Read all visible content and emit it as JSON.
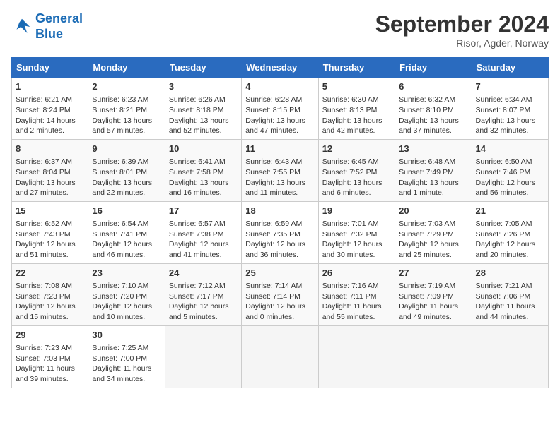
{
  "logo": {
    "line1": "General",
    "line2": "Blue"
  },
  "title": "September 2024",
  "subtitle": "Risor, Agder, Norway",
  "days_header": [
    "Sunday",
    "Monday",
    "Tuesday",
    "Wednesday",
    "Thursday",
    "Friday",
    "Saturday"
  ],
  "weeks": [
    [
      {
        "day": "1",
        "sunrise": "6:21 AM",
        "sunset": "8:24 PM",
        "daylight": "14 hours and 2 minutes."
      },
      {
        "day": "2",
        "sunrise": "6:23 AM",
        "sunset": "8:21 PM",
        "daylight": "13 hours and 57 minutes."
      },
      {
        "day": "3",
        "sunrise": "6:26 AM",
        "sunset": "8:18 PM",
        "daylight": "13 hours and 52 minutes."
      },
      {
        "day": "4",
        "sunrise": "6:28 AM",
        "sunset": "8:15 PM",
        "daylight": "13 hours and 47 minutes."
      },
      {
        "day": "5",
        "sunrise": "6:30 AM",
        "sunset": "8:13 PM",
        "daylight": "13 hours and 42 minutes."
      },
      {
        "day": "6",
        "sunrise": "6:32 AM",
        "sunset": "8:10 PM",
        "daylight": "13 hours and 37 minutes."
      },
      {
        "day": "7",
        "sunrise": "6:34 AM",
        "sunset": "8:07 PM",
        "daylight": "13 hours and 32 minutes."
      }
    ],
    [
      {
        "day": "8",
        "sunrise": "6:37 AM",
        "sunset": "8:04 PM",
        "daylight": "13 hours and 27 minutes."
      },
      {
        "day": "9",
        "sunrise": "6:39 AM",
        "sunset": "8:01 PM",
        "daylight": "13 hours and 22 minutes."
      },
      {
        "day": "10",
        "sunrise": "6:41 AM",
        "sunset": "7:58 PM",
        "daylight": "13 hours and 16 minutes."
      },
      {
        "day": "11",
        "sunrise": "6:43 AM",
        "sunset": "7:55 PM",
        "daylight": "13 hours and 11 minutes."
      },
      {
        "day": "12",
        "sunrise": "6:45 AM",
        "sunset": "7:52 PM",
        "daylight": "13 hours and 6 minutes."
      },
      {
        "day": "13",
        "sunrise": "6:48 AM",
        "sunset": "7:49 PM",
        "daylight": "13 hours and 1 minute."
      },
      {
        "day": "14",
        "sunrise": "6:50 AM",
        "sunset": "7:46 PM",
        "daylight": "12 hours and 56 minutes."
      }
    ],
    [
      {
        "day": "15",
        "sunrise": "6:52 AM",
        "sunset": "7:43 PM",
        "daylight": "12 hours and 51 minutes."
      },
      {
        "day": "16",
        "sunrise": "6:54 AM",
        "sunset": "7:41 PM",
        "daylight": "12 hours and 46 minutes."
      },
      {
        "day": "17",
        "sunrise": "6:57 AM",
        "sunset": "7:38 PM",
        "daylight": "12 hours and 41 minutes."
      },
      {
        "day": "18",
        "sunrise": "6:59 AM",
        "sunset": "7:35 PM",
        "daylight": "12 hours and 36 minutes."
      },
      {
        "day": "19",
        "sunrise": "7:01 AM",
        "sunset": "7:32 PM",
        "daylight": "12 hours and 30 minutes."
      },
      {
        "day": "20",
        "sunrise": "7:03 AM",
        "sunset": "7:29 PM",
        "daylight": "12 hours and 25 minutes."
      },
      {
        "day": "21",
        "sunrise": "7:05 AM",
        "sunset": "7:26 PM",
        "daylight": "12 hours and 20 minutes."
      }
    ],
    [
      {
        "day": "22",
        "sunrise": "7:08 AM",
        "sunset": "7:23 PM",
        "daylight": "12 hours and 15 minutes."
      },
      {
        "day": "23",
        "sunrise": "7:10 AM",
        "sunset": "7:20 PM",
        "daylight": "12 hours and 10 minutes."
      },
      {
        "day": "24",
        "sunrise": "7:12 AM",
        "sunset": "7:17 PM",
        "daylight": "12 hours and 5 minutes."
      },
      {
        "day": "25",
        "sunrise": "7:14 AM",
        "sunset": "7:14 PM",
        "daylight": "12 hours and 0 minutes."
      },
      {
        "day": "26",
        "sunrise": "7:16 AM",
        "sunset": "7:11 PM",
        "daylight": "11 hours and 55 minutes."
      },
      {
        "day": "27",
        "sunrise": "7:19 AM",
        "sunset": "7:09 PM",
        "daylight": "11 hours and 49 minutes."
      },
      {
        "day": "28",
        "sunrise": "7:21 AM",
        "sunset": "7:06 PM",
        "daylight": "11 hours and 44 minutes."
      }
    ],
    [
      {
        "day": "29",
        "sunrise": "7:23 AM",
        "sunset": "7:03 PM",
        "daylight": "11 hours and 39 minutes."
      },
      {
        "day": "30",
        "sunrise": "7:25 AM",
        "sunset": "7:00 PM",
        "daylight": "11 hours and 34 minutes."
      },
      null,
      null,
      null,
      null,
      null
    ]
  ],
  "labels": {
    "sunrise": "Sunrise:",
    "sunset": "Sunset:",
    "daylight": "Daylight:"
  }
}
